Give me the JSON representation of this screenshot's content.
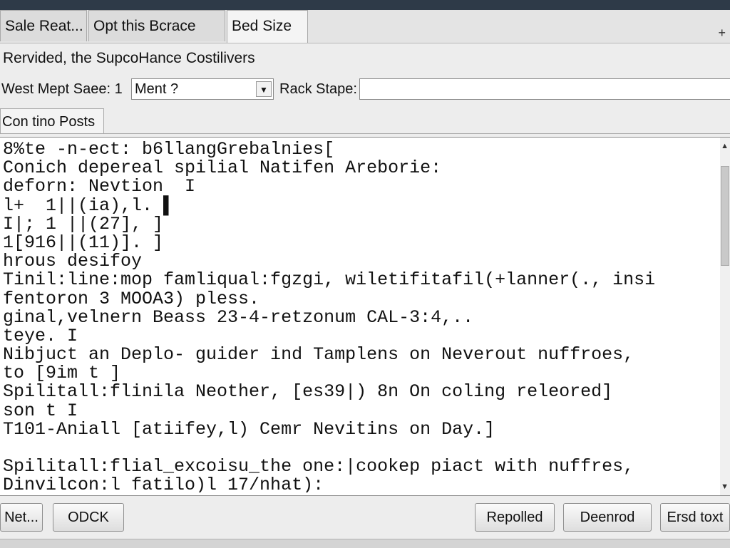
{
  "tabs": [
    {
      "label": "Sale Reat..."
    },
    {
      "label": "Opt this Bcrace"
    },
    {
      "label": "Bed Size"
    }
  ],
  "tab_close_glyph": "+",
  "subtitle": "Rervided, the SupcoHance Costilivers",
  "form": {
    "label1": "West Mept Saee: 1",
    "select_value": "Ment ?",
    "label2": "Rack Stape:",
    "text_value": ""
  },
  "section_tab": "Con tino Posts",
  "editor_lines": [
    "8%te -n-ect: b6llangGrebalnies[",
    "Conich depereal spilial Natifen Areborie:",
    "deforn: Nevtion  I",
    "l+  1||(ia),l. ▌",
    "I|; 1 ||(27], ]",
    "1[916||(11)]. ]",
    "hrous desifoy",
    "Tinil:line:mop famliqual:fgzgi, wiletifitafil(+lanner(., insi",
    "fentoron 3 MOOA3) pless.",
    "ginal,velnern Beass 23-4-retzonum CAL-3:4,..",
    "teye. I",
    "Nibjuct an Deplo- guider ind Tamplens on Neverout nuffroes,",
    "to [9im t ]",
    "Spilitall:flinila Neother, [es39|) 8n On coling releored]",
    "son t I",
    "T101-Aniall [atiifey,l) Cemr Nevitins on Day.]",
    "",
    "Spilitall:flial_excoisu_the one:|cookep piact with nuffres,",
    "Dinvilcon:l fatilo)l 17/nhat):"
  ],
  "buttons": {
    "net": "Net...",
    "odck": "ODCK",
    "repolled": "Repolled",
    "deenrod": "Deenrod",
    "ersd": "Ersd toxt"
  },
  "colors": {
    "titlebar": "#2e3a48",
    "window_bg": "#ededed",
    "editor_bg": "#ffffff"
  },
  "icons": {
    "dropdown": "chevron-down-icon",
    "scroll_up": "arrow-up-icon",
    "scroll_down": "arrow-down-icon"
  }
}
